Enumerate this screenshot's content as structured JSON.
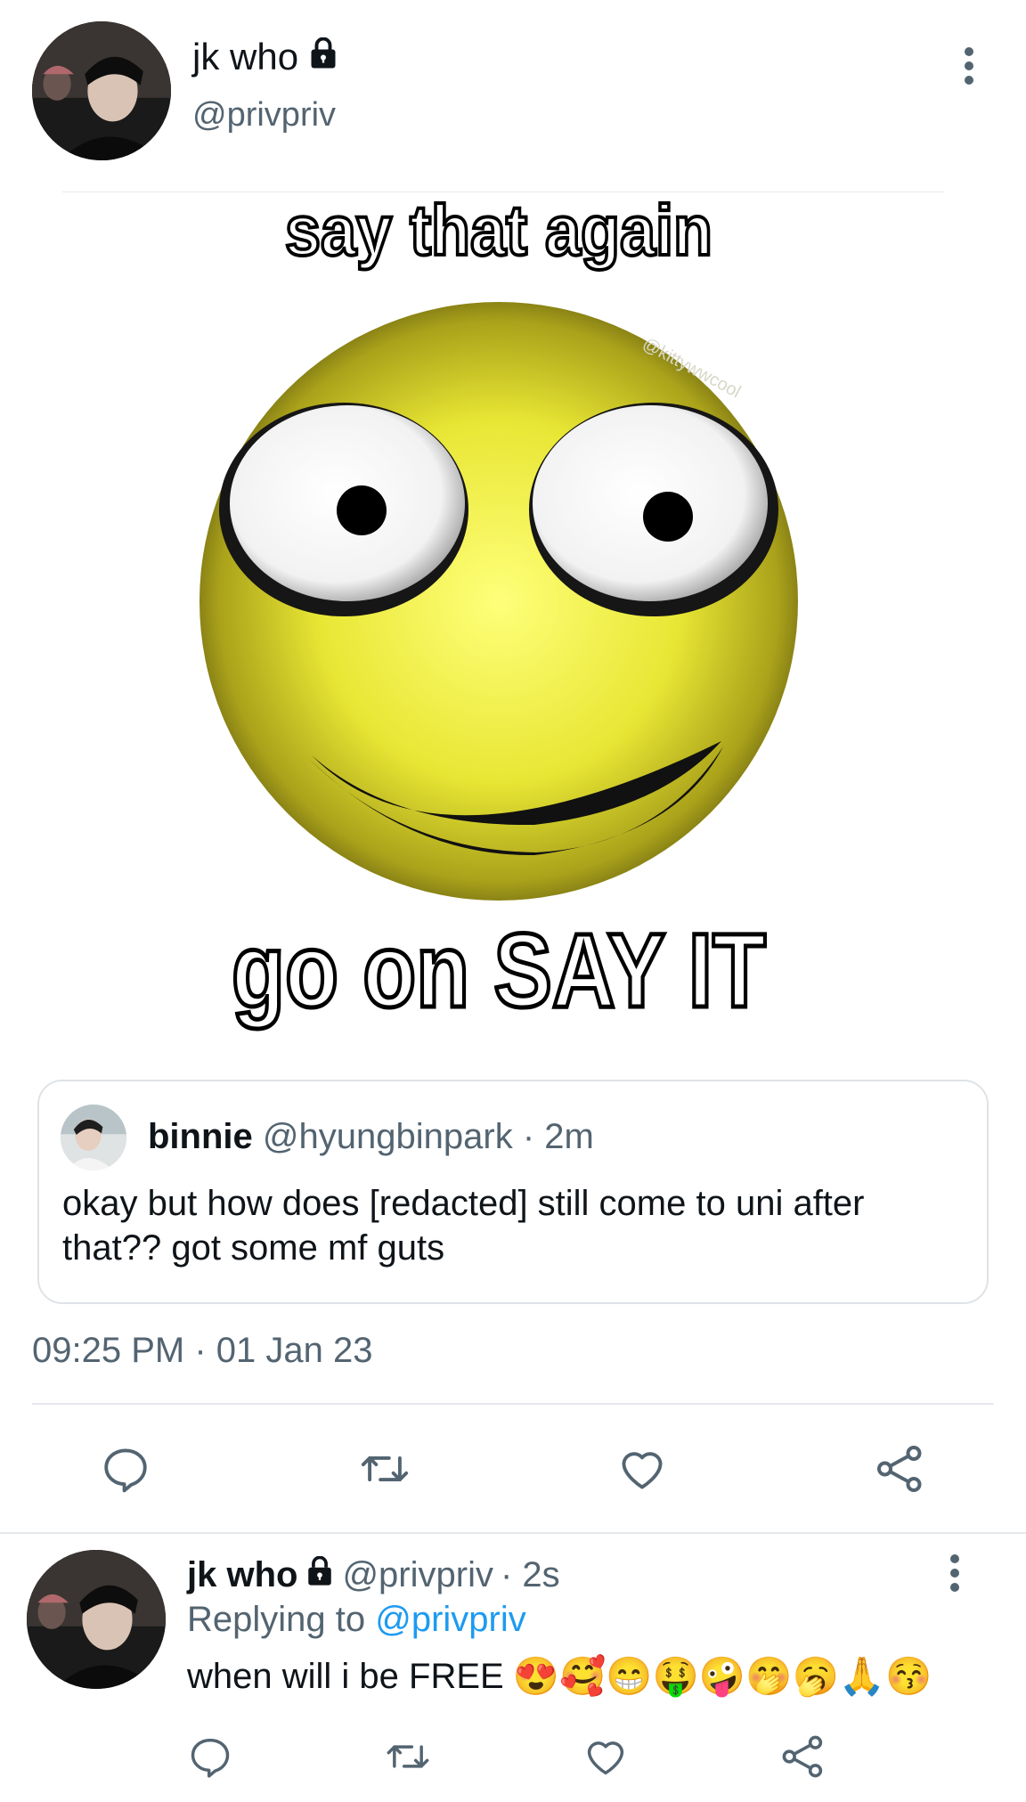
{
  "tweet": {
    "author_name": "jk who",
    "author_handle": "@privpriv",
    "meme_top_text": "say that again",
    "meme_bottom_text": "go on SAY IT",
    "meme_watermark": "@kittywwcool",
    "timestamp": "09:25 PM · 01 Jan 23",
    "quote": {
      "author_name": "binnie",
      "author_handle": "@hyungbinpark",
      "time": "· 2m",
      "text": "okay but how does [redacted] still come to uni after that?? got some mf guts"
    },
    "actions": [
      "reply-icon",
      "retweet-icon",
      "like-icon",
      "share-icon"
    ]
  },
  "reply": {
    "author_name": "jk who",
    "author_handle": "@privpriv",
    "time": "· 2s",
    "replying_label": "Replying to",
    "replying_mention": "@privpriv",
    "text": "when will i be FREE",
    "emojis": "😍🥰😁🤑🤪🤭🥱🙏😚",
    "actions": [
      "reply-icon",
      "retweet-icon",
      "like-icon",
      "share-icon"
    ]
  },
  "colors": {
    "text_primary": "#0f1419",
    "text_secondary": "#536471",
    "link": "#1d9bf0",
    "divider": "#e6e9ec"
  }
}
